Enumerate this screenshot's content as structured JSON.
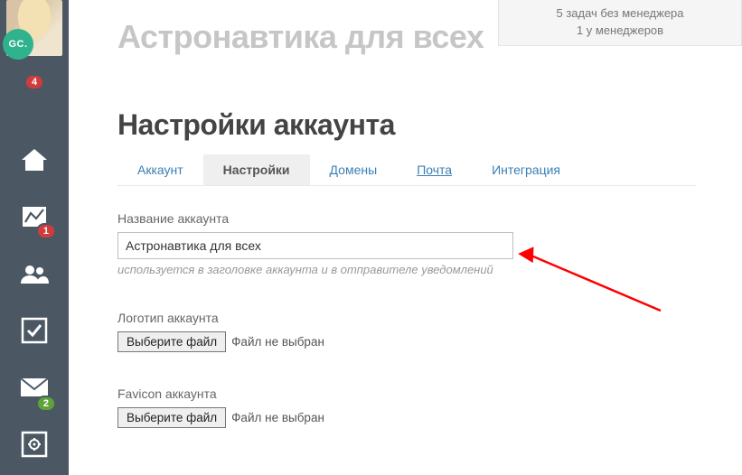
{
  "gc_badge": "GC.",
  "nav_badges": {
    "tasks": "4",
    "stats": "1",
    "mail": "2"
  },
  "topbanner": {
    "line1": "5 задач без менеджера",
    "line2": "1 у менеджеров"
  },
  "breadcrumb": "Астронавтика для всех",
  "section_title": "Настройки аккаунта",
  "tabs": {
    "account": "Аккаунт",
    "settings": "Настройки",
    "domains": "Домены",
    "mail": "Почта",
    "integration": "Интеграция"
  },
  "fields": {
    "name_label": "Название аккаунта",
    "name_value": "Астронавтика для всех",
    "name_hint": "используется в заголовке аккаунта и в отправителе уведомлений",
    "logo_label": "Логотип аккаунта",
    "favicon_label": "Favicon аккаунта",
    "file_button": "Выберите файл",
    "file_none": "Файл не выбран"
  }
}
